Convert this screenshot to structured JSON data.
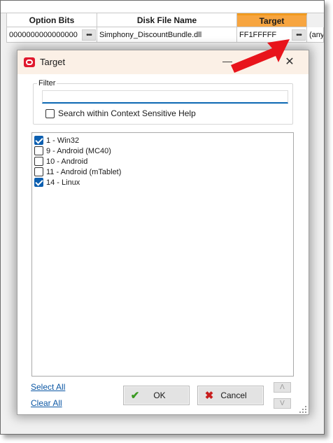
{
  "grid": {
    "headers": {
      "option_bits": "Option Bits",
      "disk_file_name": "Disk File Name",
      "target": "Target"
    },
    "row": {
      "option_bits": "0000000000000000",
      "disk_file_name": "Simphony_DiscountBundle.dll",
      "target": "FF1FFFFF",
      "next": "(any"
    },
    "ellipsis": "•••"
  },
  "dialog": {
    "title": "Target",
    "minimize_glyph": "—",
    "close_glyph": "✕",
    "filter": {
      "legend": "Filter",
      "value": "",
      "placeholder": ""
    },
    "help_checkbox": {
      "label": "Search within Context Sensitive Help",
      "checked": false
    },
    "items": [
      {
        "label": "1 - Win32",
        "checked": true
      },
      {
        "label": "9 - Android (MC40)",
        "checked": false
      },
      {
        "label": "10 - Android",
        "checked": false
      },
      {
        "label": "11 - Android (mTablet)",
        "checked": false
      },
      {
        "label": "14 - Linux",
        "checked": true
      }
    ],
    "select_all": "Select All",
    "clear_all": "Clear All",
    "ok": {
      "label": "OK",
      "icon": "check-icon"
    },
    "cancel": {
      "label": "Cancel",
      "icon": "x-icon"
    },
    "up_glyph": "Λ",
    "down_glyph": "V"
  },
  "colors": {
    "accent": "#0c5fb0",
    "header_highlight": "#f7a540",
    "arrow": "#e8141b",
    "title_bar": "#fbf0e6"
  }
}
